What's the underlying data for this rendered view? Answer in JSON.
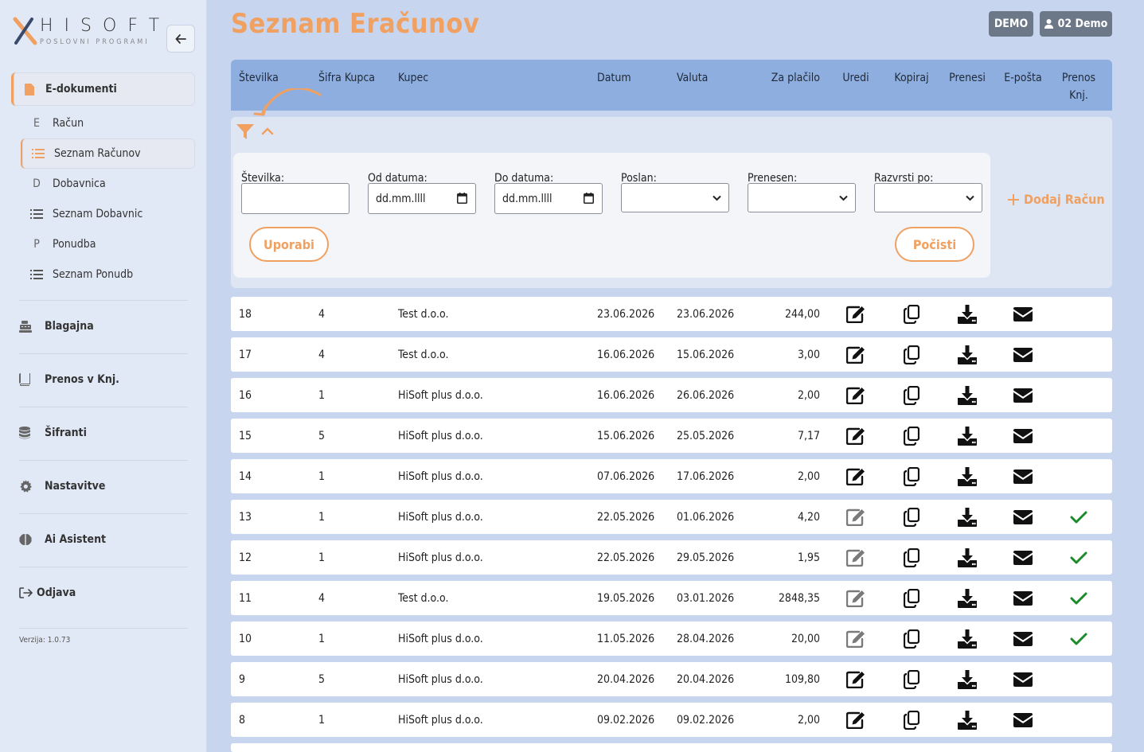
{
  "brand": {
    "name": "HISOFT",
    "tagline": "POSLOVNI PROGRAMI"
  },
  "sidebar": {
    "section_title": "E-dokumenti",
    "sub_items": [
      {
        "label": "Račun",
        "letter": "E",
        "icon": ""
      },
      {
        "label": "Seznam Računov",
        "letter": "",
        "icon": "list-icon"
      },
      {
        "label": "Dobavnica",
        "letter": "D",
        "icon": ""
      },
      {
        "label": "Seznam Dobavnic",
        "letter": "",
        "icon": "list-icon"
      },
      {
        "label": "Ponudba",
        "letter": "P",
        "icon": ""
      },
      {
        "label": "Seznam Ponudb",
        "letter": "",
        "icon": "list-icon"
      }
    ],
    "main_items": [
      {
        "label": "Blagajna",
        "icon": "cash-register-icon"
      },
      {
        "label": "Prenos v Knj.",
        "icon": "book-icon"
      },
      {
        "label": "Šifranti",
        "icon": "database-icon"
      },
      {
        "label": "Nastavitve",
        "icon": "gear-icon"
      },
      {
        "label": "Ai Asistent",
        "icon": "brain-icon"
      },
      {
        "label": "Odjava",
        "icon": "logout-icon"
      }
    ],
    "version": "Verzija: 1.0.73"
  },
  "header": {
    "title": "Seznam Eračunov",
    "badge_demo": "DEMO",
    "user_label": "02 Demo"
  },
  "table": {
    "columns": {
      "stevilka": "Številka",
      "sifra_kupca": "Šifra Kupca",
      "kupec": "Kupec",
      "datum": "Datum",
      "valuta": "Valuta",
      "za_placilo": "Za plačilo",
      "uredi": "Uredi",
      "kopiraj": "Kopiraj",
      "prenesi": "Prenesi",
      "eposta": "E-pošta",
      "prenos_knj_1": "Prenos",
      "prenos_knj_2": "Knj."
    },
    "rows": [
      {
        "stevilka": "18",
        "sifra": "4",
        "kupec": "Test d.o.o.",
        "datum": "23.06.2026",
        "valuta": "23.06.2026",
        "za_placilo": "244,00",
        "transferred": false
      },
      {
        "stevilka": "17",
        "sifra": "4",
        "kupec": "Test d.o.o.",
        "datum": "16.06.2026",
        "valuta": "15.06.2026",
        "za_placilo": "3,00",
        "transferred": false
      },
      {
        "stevilka": "16",
        "sifra": "1",
        "kupec": "HiSoft plus d.o.o.",
        "datum": "16.06.2026",
        "valuta": "26.06.2026",
        "za_placilo": "2,00",
        "transferred": false
      },
      {
        "stevilka": "15",
        "sifra": "5",
        "kupec": "HiSoft plus d.o.o.",
        "datum": "15.06.2026",
        "valuta": "25.05.2026",
        "za_placilo": "7,17",
        "transferred": false
      },
      {
        "stevilka": "14",
        "sifra": "1",
        "kupec": "HiSoft plus d.o.o.",
        "datum": "07.06.2026",
        "valuta": "17.06.2026",
        "za_placilo": "2,00",
        "transferred": false
      },
      {
        "stevilka": "13",
        "sifra": "1",
        "kupec": "HiSoft plus d.o.o.",
        "datum": "22.05.2026",
        "valuta": "01.06.2026",
        "za_placilo": "4,20",
        "transferred": true
      },
      {
        "stevilka": "12",
        "sifra": "1",
        "kupec": "HiSoft plus d.o.o.",
        "datum": "22.05.2026",
        "valuta": "29.05.2026",
        "za_placilo": "1,95",
        "transferred": true
      },
      {
        "stevilka": "11",
        "sifra": "4",
        "kupec": "Test d.o.o.",
        "datum": "19.05.2026",
        "valuta": "03.01.2026",
        "za_placilo": "2848,35",
        "transferred": true
      },
      {
        "stevilka": "10",
        "sifra": "1",
        "kupec": "HiSoft plus d.o.o.",
        "datum": "11.05.2026",
        "valuta": "28.04.2026",
        "za_placilo": "20,00",
        "transferred": true
      },
      {
        "stevilka": "9",
        "sifra": "5",
        "kupec": "HiSoft plus d.o.o.",
        "datum": "20.04.2026",
        "valuta": "20.04.2026",
        "za_placilo": "109,80",
        "transferred": false
      },
      {
        "stevilka": "8",
        "sifra": "1",
        "kupec": "HiSoft plus d.o.o.",
        "datum": "09.02.2026",
        "valuta": "09.02.2026",
        "za_placilo": "2,00",
        "transferred": false
      }
    ]
  },
  "filters": {
    "stevilka_label": "Številka:",
    "od_datuma_label": "Od datuma:",
    "do_datuma_label": "Do datuma:",
    "poslan_label": "Poslan:",
    "prenesen_label": "Prenesen:",
    "razvrsti_label": "Razvrsti po:",
    "date_placeholder": "dd.mm.llll",
    "apply_label": "Uporabi",
    "clear_label": "Počisti",
    "add_label": "Dodaj Račun"
  },
  "colors": {
    "accent": "#f0a060",
    "header": "#8faee0",
    "check": "#1a8a2a",
    "badge": "#6c7888"
  }
}
